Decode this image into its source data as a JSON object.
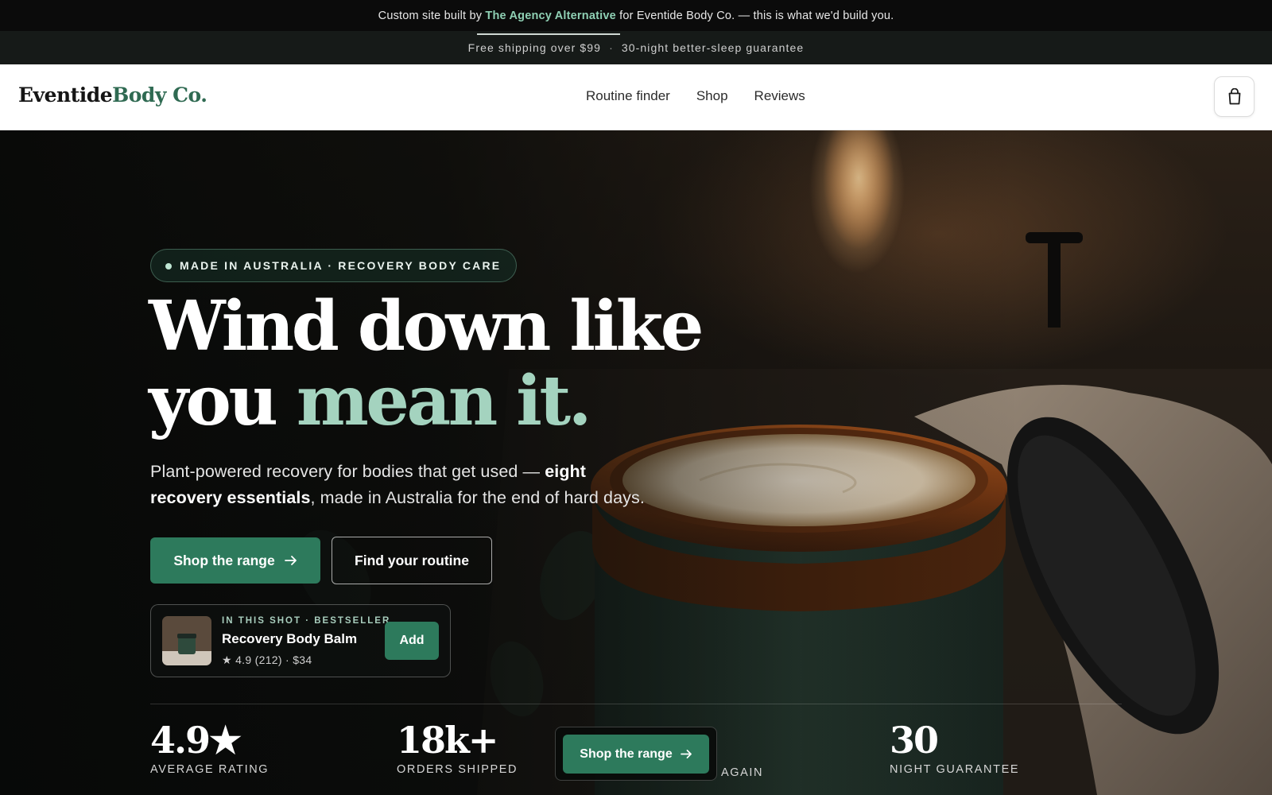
{
  "agency_bar": {
    "prefix": "Custom site built by ",
    "agency_name": "The Agency Alternative",
    "suffix": " for Eventide Body Co. — this is what we'd build you."
  },
  "promo": {
    "left": "Free shipping over $99",
    "separator": "·",
    "right": "30-night better-sleep guarantee"
  },
  "header": {
    "logo_main": "Eventide",
    "logo_accent": "Body Co.",
    "nav": [
      "Routine finder",
      "Shop",
      "Reviews"
    ],
    "cart_icon": "shopping-bag-icon"
  },
  "hero": {
    "badge": "MADE IN AUSTRALIA · RECOVERY BODY CARE",
    "title_line1": "Wind down like",
    "title_line2_plain": "you ",
    "title_line2_accent": "mean it.",
    "sub_part1": "Plant-powered recovery for bodies that get used — ",
    "sub_bold": "eight recovery essentials",
    "sub_part2": ", made in Australia for the end of hard days.",
    "primary_cta": "Shop the range",
    "secondary_cta": "Find your routine",
    "arrow_icon": "arrow-right-icon"
  },
  "product_card": {
    "eyebrow": "IN THIS SHOT · BESTSELLER",
    "name": "Recovery Body Balm",
    "rating": "4.9",
    "reviews": "(212)",
    "price": "$34",
    "add_label": "Add",
    "star_icon": "star-icon"
  },
  "stats": [
    {
      "value": "4.9★",
      "label": "AVERAGE RATING"
    },
    {
      "value": "18k+",
      "label": "ORDERS SHIPPED"
    },
    {
      "value": "",
      "label": "AGAIN"
    },
    {
      "value": "30",
      "label": "NIGHT GUARANTEE"
    }
  ],
  "sticky_cta": {
    "label": "Shop the range"
  },
  "colors": {
    "accent_green": "#2d7a5c",
    "mint": "#a4d3bf",
    "logo_green": "#2f6a52"
  }
}
